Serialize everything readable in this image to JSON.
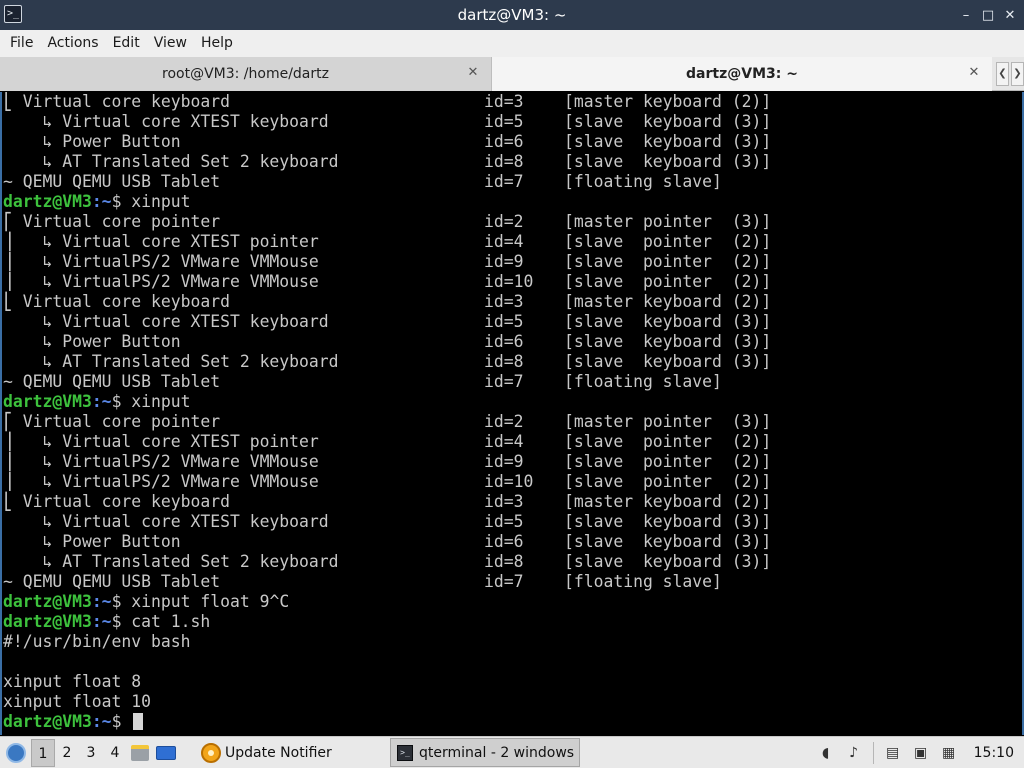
{
  "window": {
    "title": "dartz@VM3: ~",
    "app_icon_glyph": ">_",
    "buttons": {
      "minimize": "–",
      "maximize": "□",
      "close": "✕"
    }
  },
  "menu": [
    "File",
    "Actions",
    "Edit",
    "View",
    "Help"
  ],
  "tabs": [
    {
      "label": "root@VM3: /home/dartz",
      "active": false
    },
    {
      "label": "dartz@VM3: ~",
      "active": true
    }
  ],
  "tab_close_glyph": "✕",
  "tab_scroll": {
    "left": "❮",
    "right": "❯"
  },
  "terminal": {
    "colors": {
      "text": "#c8c8c8",
      "prompt_user": "#3dc23d",
      "prompt_path": "#5a87e6",
      "background": "#000000"
    },
    "lines": [
      {
        "type": "dev",
        "name": "⎣ Virtual core keyboard",
        "id": "id=3",
        "role": "[master keyboard (2)]"
      },
      {
        "type": "dev",
        "name": "    ↳ Virtual core XTEST keyboard",
        "id": "id=5",
        "role": "[slave  keyboard (3)]"
      },
      {
        "type": "dev",
        "name": "    ↳ Power Button",
        "id": "id=6",
        "role": "[slave  keyboard (3)]"
      },
      {
        "type": "dev",
        "name": "    ↳ AT Translated Set 2 keyboard",
        "id": "id=8",
        "role": "[slave  keyboard (3)]"
      },
      {
        "type": "dev",
        "name": "~ QEMU QEMU USB Tablet",
        "id": "id=7",
        "role": "[floating slave]"
      },
      {
        "type": "prompt",
        "user": "dartz@VM3",
        "path": ":~",
        "cmd": "$ xinput"
      },
      {
        "type": "dev",
        "name": "⎡ Virtual core pointer",
        "id": "id=2",
        "role": "[master pointer  (3)]"
      },
      {
        "type": "dev",
        "name": "⎥   ↳ Virtual core XTEST pointer",
        "id": "id=4",
        "role": "[slave  pointer  (2)]"
      },
      {
        "type": "dev",
        "name": "⎥   ↳ VirtualPS/2 VMware VMMouse",
        "id": "id=9",
        "role": "[slave  pointer  (2)]"
      },
      {
        "type": "dev",
        "name": "⎥   ↳ VirtualPS/2 VMware VMMouse",
        "id": "id=10",
        "role": "[slave  pointer  (2)]"
      },
      {
        "type": "dev",
        "name": "⎣ Virtual core keyboard",
        "id": "id=3",
        "role": "[master keyboard (2)]"
      },
      {
        "type": "dev",
        "name": "    ↳ Virtual core XTEST keyboard",
        "id": "id=5",
        "role": "[slave  keyboard (3)]"
      },
      {
        "type": "dev",
        "name": "    ↳ Power Button",
        "id": "id=6",
        "role": "[slave  keyboard (3)]"
      },
      {
        "type": "dev",
        "name": "    ↳ AT Translated Set 2 keyboard",
        "id": "id=8",
        "role": "[slave  keyboard (3)]"
      },
      {
        "type": "dev",
        "name": "~ QEMU QEMU USB Tablet",
        "id": "id=7",
        "role": "[floating slave]"
      },
      {
        "type": "prompt",
        "user": "dartz@VM3",
        "path": ":~",
        "cmd": "$ xinput"
      },
      {
        "type": "dev",
        "name": "⎡ Virtual core pointer",
        "id": "id=2",
        "role": "[master pointer  (3)]"
      },
      {
        "type": "dev",
        "name": "⎥   ↳ Virtual core XTEST pointer",
        "id": "id=4",
        "role": "[slave  pointer  (2)]"
      },
      {
        "type": "dev",
        "name": "⎥   ↳ VirtualPS/2 VMware VMMouse",
        "id": "id=9",
        "role": "[slave  pointer  (2)]"
      },
      {
        "type": "dev",
        "name": "⎥   ↳ VirtualPS/2 VMware VMMouse",
        "id": "id=10",
        "role": "[slave  pointer  (2)]"
      },
      {
        "type": "dev",
        "name": "⎣ Virtual core keyboard",
        "id": "id=3",
        "role": "[master keyboard (2)]"
      },
      {
        "type": "dev",
        "name": "    ↳ Virtual core XTEST keyboard",
        "id": "id=5",
        "role": "[slave  keyboard (3)]"
      },
      {
        "type": "dev",
        "name": "    ↳ Power Button",
        "id": "id=6",
        "role": "[slave  keyboard (3)]"
      },
      {
        "type": "dev",
        "name": "    ↳ AT Translated Set 2 keyboard",
        "id": "id=8",
        "role": "[slave  keyboard (3)]"
      },
      {
        "type": "dev",
        "name": "~ QEMU QEMU USB Tablet",
        "id": "id=7",
        "role": "[floating slave]"
      },
      {
        "type": "prompt",
        "user": "dartz@VM3",
        "path": ":~",
        "cmd": "$ xinput float 9^C"
      },
      {
        "type": "prompt",
        "user": "dartz@VM3",
        "path": ":~",
        "cmd": "$ cat 1.sh"
      },
      {
        "type": "text",
        "text": "#!/usr/bin/env bash"
      },
      {
        "type": "text",
        "text": ""
      },
      {
        "type": "text",
        "text": "xinput float 8"
      },
      {
        "type": "text",
        "text": "xinput float 10"
      },
      {
        "type": "prompt",
        "user": "dartz@VM3",
        "path": ":~",
        "cmd": "$ ",
        "cursor": true
      }
    ]
  },
  "taskbar": {
    "desktops": [
      "1",
      "2",
      "3",
      "4"
    ],
    "active_desktop": "1",
    "update_label": "Update Notifier",
    "task_label": "qterminal - 2 windows",
    "task_icon_glyph": ">_",
    "tray_icons": [
      "shield-icon",
      "volume-icon",
      "clipboard-icon",
      "network-icon",
      "display-icon"
    ],
    "tray_glyphs": {
      "shield": "◖",
      "volume": "♪",
      "clipboard": "▤",
      "network": "▣",
      "display": "▦"
    },
    "clock": "15:10"
  }
}
